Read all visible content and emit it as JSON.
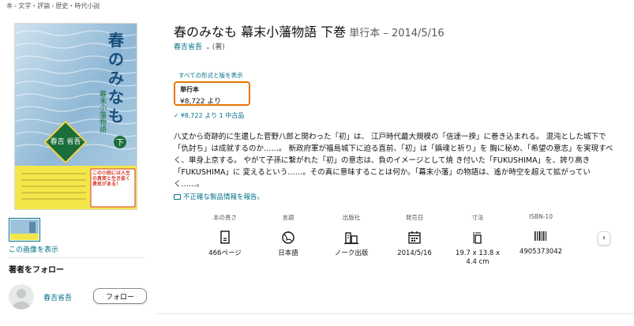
{
  "breadcrumb": [
    "本",
    "文学・評論",
    "歴史・時代小説"
  ],
  "product": {
    "title": "春のみなも 幕末小藩物語 下巻",
    "format_date": "単行本 – 2014/5/16",
    "author": "春吉省吾",
    "author_role": "(著)"
  },
  "cover": {
    "title_chars": [
      "春",
      "の",
      "み",
      "な",
      "も"
    ],
    "vertical_subtitle": "幕末小藩物語",
    "author": "春吉 省吾",
    "volume": "下",
    "band_text": "この小説には人生の真実と生き抜く勇気がある！",
    "accent": "#1a6e3a"
  },
  "gallery": {
    "view_link": "この画像を表示"
  },
  "follow": {
    "title": "著者をフォロー",
    "author": "春吉省吾",
    "button": "フォロー"
  },
  "formats": {
    "all_link": "すべての形式と版を表示",
    "selected_name": "単行本",
    "selected_price": "¥8,722 より",
    "used_offer": "¥8,722 より 1 中古品"
  },
  "description": "八丈から奇跡的に生還した菅野八郎と関わった「初」は、 江戸時代最大規模の「信達一揆」に巻き込まれる。 混沌とした城下で「仇討ち」は成就するのか……。 新政府軍が福島城下に迫る直前、「初」は「鎮魂と祈り」を 胸に秘め、「希望の意志」を実現すべく、単身上京する。 やがて子孫に繋がれた「初」の意志は、負のイメージとして焼 き付いた「FUKUSHIMA」を、誇り高き「FUKUSHIMA」に 変えるという……。その真に意味することは何か。「幕末小藩」の物語は、遙か時空を超えて拡がってい く……。",
  "report_link": "不正確な製品情報を報告。",
  "details": [
    {
      "label": "本の長さ",
      "icon": "book-pages-icon",
      "value": "466ページ"
    },
    {
      "label": "言語",
      "icon": "globe-icon",
      "value": "日本語"
    },
    {
      "label": "出版社",
      "icon": "building-icon",
      "value": "ノーク出版"
    },
    {
      "label": "発売日",
      "icon": "calendar-icon",
      "value": "2014/5/16"
    },
    {
      "label": "寸法",
      "icon": "ruler-icon",
      "value": "19.7 x 13.8 x 4.4 cm"
    },
    {
      "label": "ISBN-10",
      "icon": "barcode-icon",
      "value": "4905373042"
    }
  ],
  "colors": {
    "link": "#007185",
    "selected_border": "#e77600",
    "text": "#0f1111",
    "muted": "#565959"
  }
}
